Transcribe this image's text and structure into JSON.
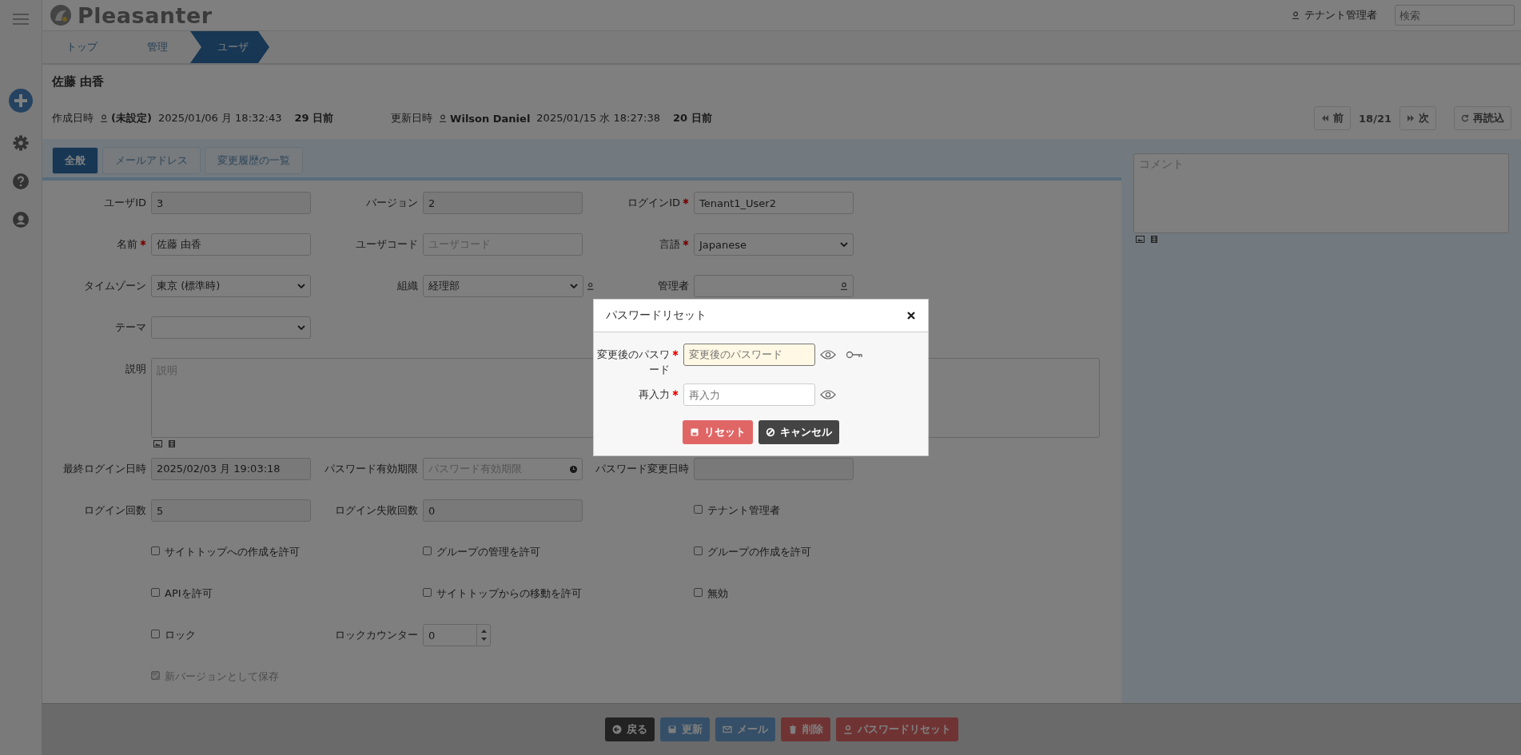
{
  "header": {
    "logo": "Pleasanter",
    "user": "テナント管理者",
    "search_placeholder": "検索"
  },
  "breadcrumb": [
    {
      "label": "トップ",
      "selected": false
    },
    {
      "label": "管理",
      "selected": false
    },
    {
      "label": "ユーザ",
      "selected": true
    }
  ],
  "record": {
    "title": "佐藤 由香",
    "created": {
      "label": "作成日時",
      "user": "(未設定)",
      "datetime": "2025/01/06 月 18:32:43",
      "ago": "29 日前"
    },
    "updated": {
      "label": "更新日時",
      "user": "Wilson Daniel",
      "datetime": "2025/01/15 水 18:27:38",
      "ago": "20 日前"
    }
  },
  "pager": {
    "prev": "前",
    "position": "18/21",
    "next": "次",
    "reload": "再読込"
  },
  "tabs": [
    {
      "label": "全般",
      "selected": true
    },
    {
      "label": "メールアドレス",
      "selected": false
    },
    {
      "label": "変更履歴の一覧",
      "selected": false
    }
  ],
  "form_rows": [
    [
      {
        "kind": "input",
        "label": "ユーザID",
        "value": "3",
        "readonly": true
      },
      {
        "kind": "input",
        "label": "バージョン",
        "value": "2",
        "readonly": true
      },
      {
        "kind": "input",
        "label": "ログインID",
        "required": true,
        "value": "Tenant1_User2"
      }
    ],
    [
      {
        "kind": "input",
        "label": "名前",
        "required": true,
        "value": "佐藤 由香"
      },
      {
        "kind": "input",
        "label": "ユーザコード",
        "placeholder": "ユーザコード"
      },
      {
        "kind": "select",
        "label": "言語",
        "required": true,
        "value": "Japanese"
      }
    ],
    [
      {
        "kind": "select",
        "label": "タイムゾーン",
        "value": "東京 (標準時)"
      },
      {
        "kind": "select_user",
        "label": "組織",
        "value": "経理部"
      },
      {
        "kind": "user",
        "label": "管理者"
      }
    ],
    [
      {
        "kind": "select",
        "label": "テーマ"
      }
    ]
  ],
  "description": {
    "label": "説明",
    "placeholder": "説明"
  },
  "form_rows_2": [
    [
      {
        "kind": "input",
        "label": "最終ログイン日時",
        "value": "2025/02/03 月 19:03:18",
        "readonly": true
      },
      {
        "kind": "date",
        "label": "パスワード有効期限",
        "placeholder": "パスワード有効期限"
      },
      {
        "kind": "input",
        "label": "パスワード変更日時",
        "readonly": true
      }
    ],
    [
      {
        "kind": "input",
        "label": "ログイン回数",
        "value": "5",
        "readonly": true
      },
      {
        "kind": "input",
        "label": "ログイン失敗回数",
        "value": "0",
        "readonly": true
      },
      {
        "kind": "checkbox",
        "label": "テナント管理者",
        "checked": false
      }
    ],
    [
      {
        "kind": "checkbox",
        "label": "サイトトップへの作成を許可",
        "checked": false
      },
      {
        "kind": "checkbox",
        "label": "グループの管理を許可",
        "checked": false
      },
      {
        "kind": "checkbox",
        "label": "グループの作成を許可",
        "checked": false
      }
    ],
    [
      {
        "kind": "checkbox",
        "label": "APIを許可",
        "checked": false
      },
      {
        "kind": "checkbox",
        "label": "サイトトップからの移動を許可",
        "checked": false
      },
      {
        "kind": "checkbox",
        "label": "無効",
        "checked": false
      }
    ],
    [
      {
        "kind": "checkbox",
        "label": "ロック",
        "checked": false
      },
      {
        "kind": "number",
        "label": "ロックカウンター",
        "value": "0"
      }
    ],
    [
      {
        "kind": "checkbox",
        "label": "新バージョンとして保存",
        "checked": true,
        "disabled": true
      }
    ]
  ],
  "comment": {
    "placeholder": "コメント"
  },
  "footer_buttons": [
    {
      "label": "戻る",
      "kind": "back"
    },
    {
      "label": "更新",
      "kind": "update"
    },
    {
      "label": "メール",
      "kind": "mail"
    },
    {
      "label": "削除",
      "kind": "delete"
    },
    {
      "label": "パスワードリセット",
      "kind": "password"
    }
  ],
  "dialog": {
    "title": "パスワードリセット",
    "fields": [
      {
        "kind": "new",
        "label": "変更後のパスワード",
        "required": true,
        "placeholder": "変更後のパスワード",
        "focused": true
      },
      {
        "kind": "confirm",
        "label": "再入力",
        "required": true,
        "placeholder": "再入力",
        "focused": false
      }
    ],
    "buttons": [
      {
        "label": "リセット",
        "kind": "reset"
      },
      {
        "label": "キャンセル",
        "kind": "cancel"
      }
    ]
  }
}
